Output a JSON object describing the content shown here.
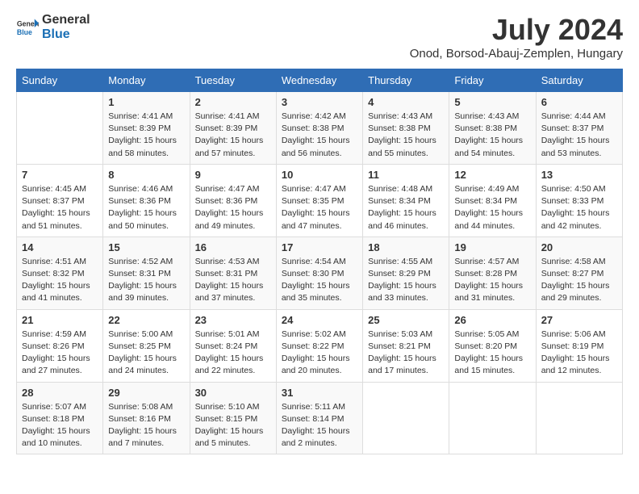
{
  "header": {
    "logo_line1": "General",
    "logo_line2": "Blue",
    "month": "July 2024",
    "location": "Onod, Borsod-Abauj-Zemplen, Hungary"
  },
  "weekdays": [
    "Sunday",
    "Monday",
    "Tuesday",
    "Wednesday",
    "Thursday",
    "Friday",
    "Saturday"
  ],
  "weeks": [
    [
      {
        "day": "",
        "info": ""
      },
      {
        "day": "1",
        "info": "Sunrise: 4:41 AM\nSunset: 8:39 PM\nDaylight: 15 hours\nand 58 minutes."
      },
      {
        "day": "2",
        "info": "Sunrise: 4:41 AM\nSunset: 8:39 PM\nDaylight: 15 hours\nand 57 minutes."
      },
      {
        "day": "3",
        "info": "Sunrise: 4:42 AM\nSunset: 8:38 PM\nDaylight: 15 hours\nand 56 minutes."
      },
      {
        "day": "4",
        "info": "Sunrise: 4:43 AM\nSunset: 8:38 PM\nDaylight: 15 hours\nand 55 minutes."
      },
      {
        "day": "5",
        "info": "Sunrise: 4:43 AM\nSunset: 8:38 PM\nDaylight: 15 hours\nand 54 minutes."
      },
      {
        "day": "6",
        "info": "Sunrise: 4:44 AM\nSunset: 8:37 PM\nDaylight: 15 hours\nand 53 minutes."
      }
    ],
    [
      {
        "day": "7",
        "info": "Sunrise: 4:45 AM\nSunset: 8:37 PM\nDaylight: 15 hours\nand 51 minutes."
      },
      {
        "day": "8",
        "info": "Sunrise: 4:46 AM\nSunset: 8:36 PM\nDaylight: 15 hours\nand 50 minutes."
      },
      {
        "day": "9",
        "info": "Sunrise: 4:47 AM\nSunset: 8:36 PM\nDaylight: 15 hours\nand 49 minutes."
      },
      {
        "day": "10",
        "info": "Sunrise: 4:47 AM\nSunset: 8:35 PM\nDaylight: 15 hours\nand 47 minutes."
      },
      {
        "day": "11",
        "info": "Sunrise: 4:48 AM\nSunset: 8:34 PM\nDaylight: 15 hours\nand 46 minutes."
      },
      {
        "day": "12",
        "info": "Sunrise: 4:49 AM\nSunset: 8:34 PM\nDaylight: 15 hours\nand 44 minutes."
      },
      {
        "day": "13",
        "info": "Sunrise: 4:50 AM\nSunset: 8:33 PM\nDaylight: 15 hours\nand 42 minutes."
      }
    ],
    [
      {
        "day": "14",
        "info": "Sunrise: 4:51 AM\nSunset: 8:32 PM\nDaylight: 15 hours\nand 41 minutes."
      },
      {
        "day": "15",
        "info": "Sunrise: 4:52 AM\nSunset: 8:31 PM\nDaylight: 15 hours\nand 39 minutes."
      },
      {
        "day": "16",
        "info": "Sunrise: 4:53 AM\nSunset: 8:31 PM\nDaylight: 15 hours\nand 37 minutes."
      },
      {
        "day": "17",
        "info": "Sunrise: 4:54 AM\nSunset: 8:30 PM\nDaylight: 15 hours\nand 35 minutes."
      },
      {
        "day": "18",
        "info": "Sunrise: 4:55 AM\nSunset: 8:29 PM\nDaylight: 15 hours\nand 33 minutes."
      },
      {
        "day": "19",
        "info": "Sunrise: 4:57 AM\nSunset: 8:28 PM\nDaylight: 15 hours\nand 31 minutes."
      },
      {
        "day": "20",
        "info": "Sunrise: 4:58 AM\nSunset: 8:27 PM\nDaylight: 15 hours\nand 29 minutes."
      }
    ],
    [
      {
        "day": "21",
        "info": "Sunrise: 4:59 AM\nSunset: 8:26 PM\nDaylight: 15 hours\nand 27 minutes."
      },
      {
        "day": "22",
        "info": "Sunrise: 5:00 AM\nSunset: 8:25 PM\nDaylight: 15 hours\nand 24 minutes."
      },
      {
        "day": "23",
        "info": "Sunrise: 5:01 AM\nSunset: 8:24 PM\nDaylight: 15 hours\nand 22 minutes."
      },
      {
        "day": "24",
        "info": "Sunrise: 5:02 AM\nSunset: 8:22 PM\nDaylight: 15 hours\nand 20 minutes."
      },
      {
        "day": "25",
        "info": "Sunrise: 5:03 AM\nSunset: 8:21 PM\nDaylight: 15 hours\nand 17 minutes."
      },
      {
        "day": "26",
        "info": "Sunrise: 5:05 AM\nSunset: 8:20 PM\nDaylight: 15 hours\nand 15 minutes."
      },
      {
        "day": "27",
        "info": "Sunrise: 5:06 AM\nSunset: 8:19 PM\nDaylight: 15 hours\nand 12 minutes."
      }
    ],
    [
      {
        "day": "28",
        "info": "Sunrise: 5:07 AM\nSunset: 8:18 PM\nDaylight: 15 hours\nand 10 minutes."
      },
      {
        "day": "29",
        "info": "Sunrise: 5:08 AM\nSunset: 8:16 PM\nDaylight: 15 hours\nand 7 minutes."
      },
      {
        "day": "30",
        "info": "Sunrise: 5:10 AM\nSunset: 8:15 PM\nDaylight: 15 hours\nand 5 minutes."
      },
      {
        "day": "31",
        "info": "Sunrise: 5:11 AM\nSunset: 8:14 PM\nDaylight: 15 hours\nand 2 minutes."
      },
      {
        "day": "",
        "info": ""
      },
      {
        "day": "",
        "info": ""
      },
      {
        "day": "",
        "info": ""
      }
    ]
  ]
}
